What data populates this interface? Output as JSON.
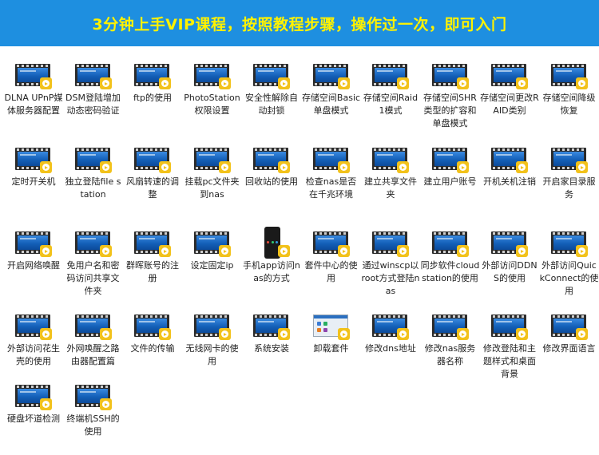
{
  "banner": {
    "title": "3分钟上手VIP课程，按照教程步骤，操作过一次，即可入门"
  },
  "colors": {
    "banner_bg": "#1e8fe0",
    "banner_text": "#fff200",
    "play_badge": "#f2c21b"
  },
  "videos": [
    {
      "label": "DLNA UPnP媒体服务器配置",
      "icon": "video-icon"
    },
    {
      "label": "DSM登陆增加动态密码验证",
      "icon": "video-icon"
    },
    {
      "label": "ftp的使用",
      "icon": "video-icon"
    },
    {
      "label": "PhotoStation权限设置",
      "icon": "video-icon"
    },
    {
      "label": "安全性解除自动封锁",
      "icon": "video-icon"
    },
    {
      "label": "存储空间Basic单盘模式",
      "icon": "video-icon"
    },
    {
      "label": "存储空间Raid1模式",
      "icon": "video-icon"
    },
    {
      "label": "存储空间SHR类型的扩容和单盘模式",
      "icon": "video-icon"
    },
    {
      "label": "存储空间更改RAID类别",
      "icon": "video-icon"
    },
    {
      "label": "存储空间降级恢复",
      "icon": "video-icon"
    },
    {
      "label": "定时开关机",
      "icon": "video-icon"
    },
    {
      "label": "独立登陆file station",
      "icon": "video-icon"
    },
    {
      "label": "风扇转速的调整",
      "icon": "video-icon"
    },
    {
      "label": "挂载pc文件夹到nas",
      "icon": "video-icon"
    },
    {
      "label": "回收站的使用",
      "icon": "video-icon"
    },
    {
      "label": "检查nas是否在千兆环境",
      "icon": "video-icon"
    },
    {
      "label": "建立共享文件夹",
      "icon": "video-icon"
    },
    {
      "label": "建立用户账号",
      "icon": "video-icon"
    },
    {
      "label": "开机关机注销",
      "icon": "video-icon"
    },
    {
      "label": "开启家目录服务",
      "icon": "video-icon"
    },
    {
      "label": "开启网络唤醒",
      "icon": "video-icon"
    },
    {
      "label": "免用户名和密码访问共享文件夹",
      "icon": "video-icon"
    },
    {
      "label": "群晖账号的注册",
      "icon": "video-icon"
    },
    {
      "label": "设定固定ip",
      "icon": "video-icon"
    },
    {
      "label": "手机app访问nas的方式",
      "icon": "phone-video-icon"
    },
    {
      "label": "套件中心的使用",
      "icon": "video-icon"
    },
    {
      "label": "通过winscp以root方式登陆nas",
      "icon": "video-icon"
    },
    {
      "label": "同步软件cloud station的使用",
      "icon": "video-icon"
    },
    {
      "label": "外部访问DDNS的使用",
      "icon": "video-icon"
    },
    {
      "label": "外部访问QuickConnect的使用",
      "icon": "video-icon"
    },
    {
      "label": "外部访问花生壳的使用",
      "icon": "video-icon"
    },
    {
      "label": "外网唤醒之路由器配置篇",
      "icon": "video-icon"
    },
    {
      "label": "文件的传输",
      "icon": "video-icon"
    },
    {
      "label": "无线网卡的使用",
      "icon": "video-icon"
    },
    {
      "label": "系统安装",
      "icon": "video-icon"
    },
    {
      "label": "卸载套件",
      "icon": "screenshot-video-icon"
    },
    {
      "label": "修改dns地址",
      "icon": "video-icon"
    },
    {
      "label": "修改nas服务器名称",
      "icon": "video-icon"
    },
    {
      "label": "修改登陆和主题样式和桌面背景",
      "icon": "video-icon"
    },
    {
      "label": "修改界面语言",
      "icon": "video-icon"
    },
    {
      "label": "硬盘坏道检测",
      "icon": "video-icon"
    },
    {
      "label": "终端机SSH的使用",
      "icon": "video-icon"
    }
  ]
}
